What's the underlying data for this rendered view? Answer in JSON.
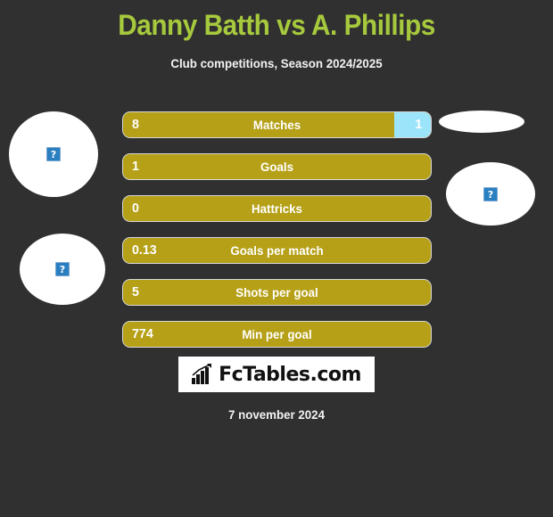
{
  "header": {
    "title": "Danny Batth vs A. Phillips",
    "subtitle": "Club competitions, Season 2024/2025",
    "title_color": "#a6c93d",
    "subtitle_color": "#f2f2f2"
  },
  "theme": {
    "background": "#303030",
    "home_color": "#b5a017",
    "away_color": "#9ce4fa",
    "bar_border": "#d8d8d8",
    "text_on_bar": "#ffffff"
  },
  "players": {
    "home": {
      "name": "Danny Batth",
      "avatar_placeholder": "broken-image-icon"
    },
    "away": {
      "name": "A. Phillips",
      "avatar_placeholder": "broken-image-icon"
    }
  },
  "stats": [
    {
      "label": "Matches",
      "home": "8",
      "away": "1",
      "home_pct": 88,
      "away_pct": 12
    },
    {
      "label": "Goals",
      "home": "1",
      "away": "",
      "home_pct": 100,
      "away_pct": 0
    },
    {
      "label": "Hattricks",
      "home": "0",
      "away": "",
      "home_pct": 100,
      "away_pct": 0
    },
    {
      "label": "Goals per match",
      "home": "0.13",
      "away": "",
      "home_pct": 100,
      "away_pct": 0
    },
    {
      "label": "Shots per goal",
      "home": "5",
      "away": "",
      "home_pct": 100,
      "away_pct": 0
    },
    {
      "label": "Min per goal",
      "home": "774",
      "away": "",
      "home_pct": 100,
      "away_pct": 0
    }
  ],
  "logo": {
    "text": "FcTables.com",
    "icon": "bar-chart-trend-icon"
  },
  "footer": {
    "date": "7 november 2024"
  }
}
